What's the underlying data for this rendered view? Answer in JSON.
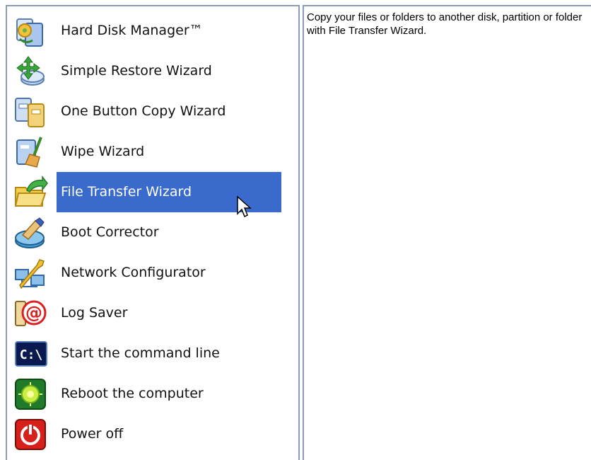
{
  "menu": {
    "items": [
      {
        "label": "Hard Disk Manager™",
        "icon": "hdm-icon"
      },
      {
        "label": "Simple Restore Wizard",
        "icon": "restore-icon"
      },
      {
        "label": "One Button Copy Wizard",
        "icon": "copy-icon"
      },
      {
        "label": "Wipe Wizard",
        "icon": "wipe-icon"
      },
      {
        "label": "File Transfer Wizard",
        "icon": "file-transfer-icon",
        "selected": true
      },
      {
        "label": "Boot Corrector",
        "icon": "boot-corrector-icon"
      },
      {
        "label": "Network Configurator",
        "icon": "network-icon"
      },
      {
        "label": "Log Saver",
        "icon": "log-saver-icon"
      },
      {
        "label": "Start the command line",
        "icon": "command-line-icon"
      },
      {
        "label": "Reboot the computer",
        "icon": "reboot-icon"
      },
      {
        "label": "Power off",
        "icon": "power-icon"
      }
    ],
    "selected_color": "#3a6bcc"
  },
  "description": {
    "text": "Copy your files or folders to another disk, partition or folder with File Transfer Wizard."
  }
}
